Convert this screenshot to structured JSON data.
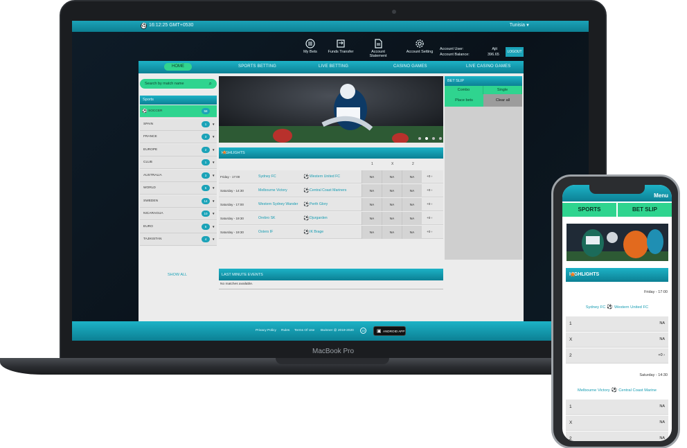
{
  "laptop": {
    "brand": "MacBook Pro",
    "topbar": {
      "time": "16:12:25 GMT+0530",
      "language": "Tunisia"
    },
    "account_nav": [
      {
        "label": "My Bets",
        "icon": "list-icon"
      },
      {
        "label": "Funds Transfer",
        "icon": "transfer-icon"
      },
      {
        "label": "Account Statement",
        "icon": "document-icon"
      },
      {
        "label": "Account Setting",
        "icon": "gear-icon"
      }
    ],
    "account_user_label": "Account User:",
    "account_balance_label": "Account Balance:",
    "account_user": "Ajit",
    "account_balance": "396.65",
    "logout": "LOGOUT",
    "nav": [
      "HOME",
      "SPORTS BETTING",
      "LIVE BETTING",
      "CASINO GAMES",
      "LIVE CASINO GAMES"
    ],
    "search": {
      "placeholder": "Search by match name"
    },
    "sports_header": "Sports",
    "sports": [
      {
        "name": "SOCCER",
        "count": "58"
      },
      {
        "name": "SPAIN",
        "count": "1"
      },
      {
        "name": "FRANCE",
        "count": "3"
      },
      {
        "name": "EUROPE",
        "count": "2"
      },
      {
        "name": "CLUB",
        "count": "1"
      },
      {
        "name": "AUSTRALIA",
        "count": "3"
      },
      {
        "name": "WORLD",
        "count": "5"
      },
      {
        "name": "SWEDEN",
        "count": "14"
      },
      {
        "name": "NICARAGUA",
        "count": "10"
      },
      {
        "name": "EURO",
        "count": "5"
      },
      {
        "name": "TAJIKISTAN",
        "count": "4"
      }
    ],
    "show_all": "SHOW ALL",
    "highlights": {
      "title": "HIGHLIGHTS",
      "columns": [
        "1",
        "X",
        "2"
      ],
      "matches": [
        {
          "date": "Friday - 17:00",
          "home": "Sydney FC",
          "away": "Western United FC",
          "o1": "NA",
          "ox": "NA",
          "o2": "NA",
          "more": "+0 ›"
        },
        {
          "date": "Saturday - 14:30",
          "home": "Melbourne Victory",
          "away": "Central Coast Mariners",
          "o1": "NA",
          "ox": "NA",
          "o2": "NA",
          "more": "+0 ›"
        },
        {
          "date": "Saturday - 17:00",
          "home": "Western Sydney Wander",
          "away": "Perth Glory",
          "o1": "NA",
          "ox": "NA",
          "o2": "NA",
          "more": "+0 ›"
        },
        {
          "date": "Saturday - 19:30",
          "home": "Orebro SK",
          "away": "Djurgarden",
          "o1": "NA",
          "ox": "NA",
          "o2": "NA",
          "more": "+0 ›"
        },
        {
          "date": "Saturday - 19:30",
          "home": "Osters IF",
          "away": "IK Brage",
          "o1": "NA",
          "ox": "NA",
          "o2": "NA",
          "more": "+0 ›"
        }
      ]
    },
    "last_minute": {
      "title": "LAST MINUTE EVENTS",
      "empty": "No matches available."
    },
    "betslip": {
      "title": "BET SLIP",
      "tab_combo": "Combo",
      "tab_single": "Single",
      "place": "Place bets",
      "clear": "Clear all"
    },
    "footer": {
      "links": [
        "Privacy Policy",
        "Rules",
        "Terms Of Use"
      ],
      "copyright": "Bwinner @ 2019-2020",
      "age_badge": "18",
      "app_button": "ANDROID APP"
    },
    "colors": {
      "teal": "#1ba3b8",
      "green": "#2fd48f",
      "orange": "#ff7a1a"
    }
  },
  "phone": {
    "menu": "Menu",
    "tabs": [
      "SPORTS",
      "BET SLIP"
    ],
    "highlights_title": "HIGHLIGHTS",
    "matches": [
      {
        "date": "Friday - 17:00",
        "home": "Sydney FC",
        "away": "Western United FC",
        "odds": [
          {
            "k": "1",
            "v": "NA"
          },
          {
            "k": "X",
            "v": "NA"
          },
          {
            "k": "2",
            "v": "+0 ›"
          }
        ]
      },
      {
        "date": "Saturday - 14:30",
        "home": "Melbourne Victory",
        "away": "Central Coast Marine",
        "odds": [
          {
            "k": "1",
            "v": "NA"
          },
          {
            "k": "X",
            "v": "NA"
          },
          {
            "k": "2",
            "v": "NA"
          }
        ]
      }
    ]
  }
}
